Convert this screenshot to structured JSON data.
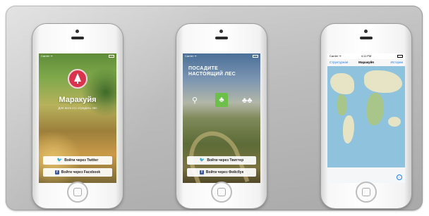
{
  "phones": [
    {
      "status": {
        "carrier": "Carrier ᯤ"
      },
      "app_name": "Маракуйя",
      "tagline": "Для всех кто отрадить лес",
      "buttons": [
        {
          "icon": "twitter-icon",
          "label": "Войти через Twitter"
        },
        {
          "icon": "facebook-icon",
          "label": "Войти через Facebook"
        }
      ]
    },
    {
      "status": {
        "carrier": "Carrier ᯤ"
      },
      "headline_line1": "ПОСАДИТЕ",
      "headline_line2": "НАСТОЯЩИЙ ЛЕС",
      "features": [
        {
          "icon": "pin-icon",
          "caption": ""
        },
        {
          "icon": "tree-icon",
          "caption": ""
        },
        {
          "icon": "forest-icon",
          "caption": ""
        }
      ],
      "buttons": [
        {
          "icon": "twitter-icon",
          "label": "Войти через Твиттер"
        },
        {
          "icon": "facebook-icon",
          "label": "Войти через Фейсбук"
        }
      ]
    },
    {
      "status": {
        "carrier": "Carrier ᯤ",
        "time": "4:11 PM"
      },
      "nav": {
        "left": "Структурная",
        "title": "Маракуйя",
        "right": "Истории"
      }
    }
  ],
  "colors": {
    "accent_red": "#d9344d",
    "link_blue": "#1a7cf0",
    "twitter_blue": "#2aa9e0",
    "facebook_blue": "#3b5998",
    "feature_green": "#6cc04a"
  }
}
